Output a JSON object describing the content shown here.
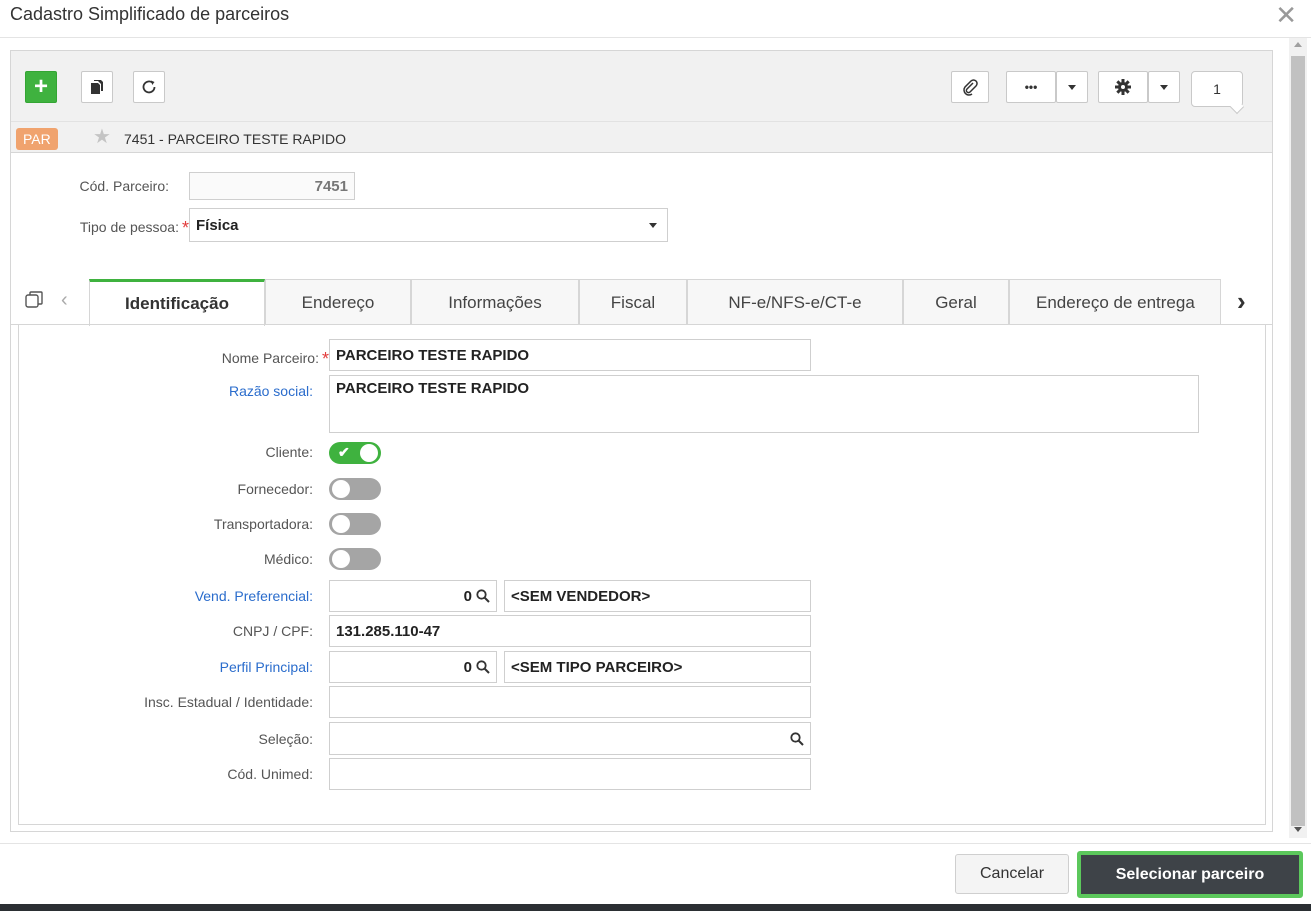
{
  "dialog": {
    "title": "Cadastro Simplificado de parceiros",
    "close_glyph": "✕"
  },
  "toolbar": {
    "add_glyph": "+",
    "more_glyph": "•••",
    "page_number": "1"
  },
  "record": {
    "badge": "PAR",
    "star_glyph": "★",
    "title": "7451 - PARCEIRO TESTE RAPIDO"
  },
  "header_form": {
    "cod_parceiro_label": "Cód. Parceiro:",
    "cod_parceiro_value": "7451",
    "tipo_pessoa_label": "Tipo de pessoa:",
    "tipo_pessoa_value": "Física",
    "required_mark": "*"
  },
  "tabs": [
    {
      "label": "Identificação"
    },
    {
      "label": "Endereço"
    },
    {
      "label": "Informações"
    },
    {
      "label": "Fiscal"
    },
    {
      "label": "NF-e/NFS-e/CT-e"
    },
    {
      "label": "Geral"
    },
    {
      "label": "Endereço de entrega"
    }
  ],
  "identificacao": {
    "nome_parceiro_label": "Nome Parceiro:",
    "nome_parceiro_value": "PARCEIRO TESTE RAPIDO",
    "razao_social_label": "Razão social:",
    "razao_social_value": "PARCEIRO TESTE RAPIDO",
    "cliente_label": "Cliente:",
    "fornecedor_label": "Fornecedor:",
    "transportadora_label": "Transportadora:",
    "medico_label": "Médico:",
    "vend_preferencial_label": "Vend. Preferencial:",
    "vend_preferencial_code": "0",
    "vend_preferencial_desc": "<SEM VENDEDOR>",
    "cnpj_cpf_label": "CNPJ / CPF:",
    "cnpj_cpf_value": "131.285.110-47",
    "perfil_principal_label": "Perfil Principal:",
    "perfil_principal_code": "0",
    "perfil_principal_desc": "<SEM TIPO PARCEIRO>",
    "insc_estadual_label": "Insc. Estadual / Identidade:",
    "insc_estadual_value": "",
    "selecao_label": "Seleção:",
    "selecao_value": "",
    "cod_unimed_label": "Cód. Unimed:",
    "cod_unimed_value": "",
    "check_glyph": "✔"
  },
  "toggles": {
    "cliente": true,
    "fornecedor": false,
    "transportadora": false,
    "medico": false
  },
  "footer": {
    "cancel_label": "Cancelar",
    "select_label": "Selecionar parceiro"
  },
  "colors": {
    "accent_green": "#3fb23f",
    "badge_orange": "#f0a36e",
    "link_blue": "#2a6ccc",
    "required_red": "#e23c3c",
    "primary_button": "#3e4348"
  }
}
